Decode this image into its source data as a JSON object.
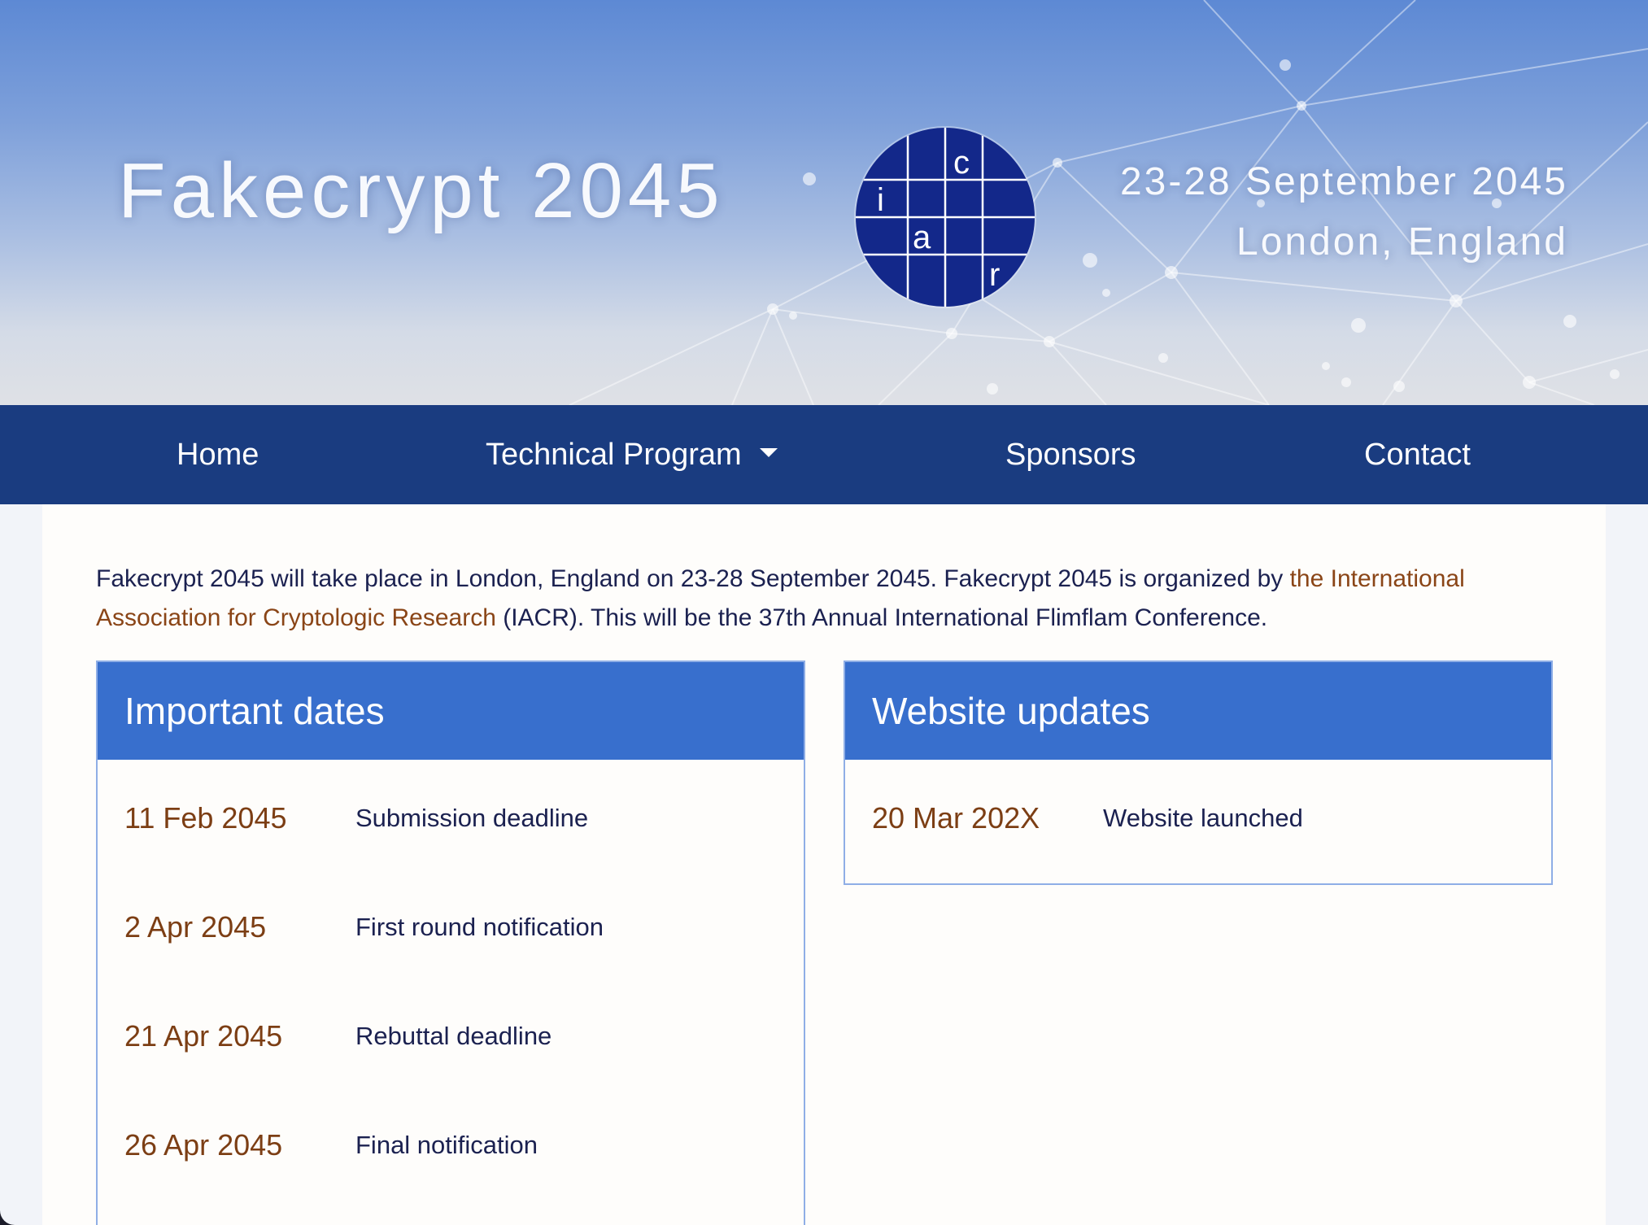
{
  "header": {
    "title": "Fakecrypt 2045",
    "dates": "23-28 September 2045",
    "location": "London, England",
    "logo_letters": [
      "c",
      "i",
      "a",
      "r"
    ]
  },
  "nav": {
    "items": [
      {
        "label": "Home"
      },
      {
        "label": "Technical Program",
        "has_dropdown": true
      },
      {
        "label": "Sponsors"
      },
      {
        "label": "Contact"
      }
    ]
  },
  "intro": {
    "text_before": "Fakecrypt 2045 will take place in London, England on 23-28 September 2045. Fakecrypt 2045 is organized by ",
    "link_text": "the International Association for Cryptologic Research",
    "text_after": " (IACR). This will be the 37th Annual International Flimflam Conference."
  },
  "important_dates": {
    "title": "Important dates",
    "items": [
      {
        "date": "11 Feb 2045",
        "label": "Submission deadline"
      },
      {
        "date": "2 Apr 2045",
        "label": "First round notification"
      },
      {
        "date": "21 Apr 2045",
        "label": "Rebuttal deadline"
      },
      {
        "date": "26 Apr 2045",
        "label": "Final notification"
      }
    ]
  },
  "website_updates": {
    "title": "Website updates",
    "items": [
      {
        "date": "20 Mar 202X",
        "label": "Website launched"
      }
    ]
  },
  "colors": {
    "nav_bg": "#1a3c80",
    "card_header_bg": "#386fcd",
    "date_text": "#7c3e14",
    "link_text": "#8a4517",
    "body_text": "#1b2150",
    "logo_bg": "#13288a"
  }
}
